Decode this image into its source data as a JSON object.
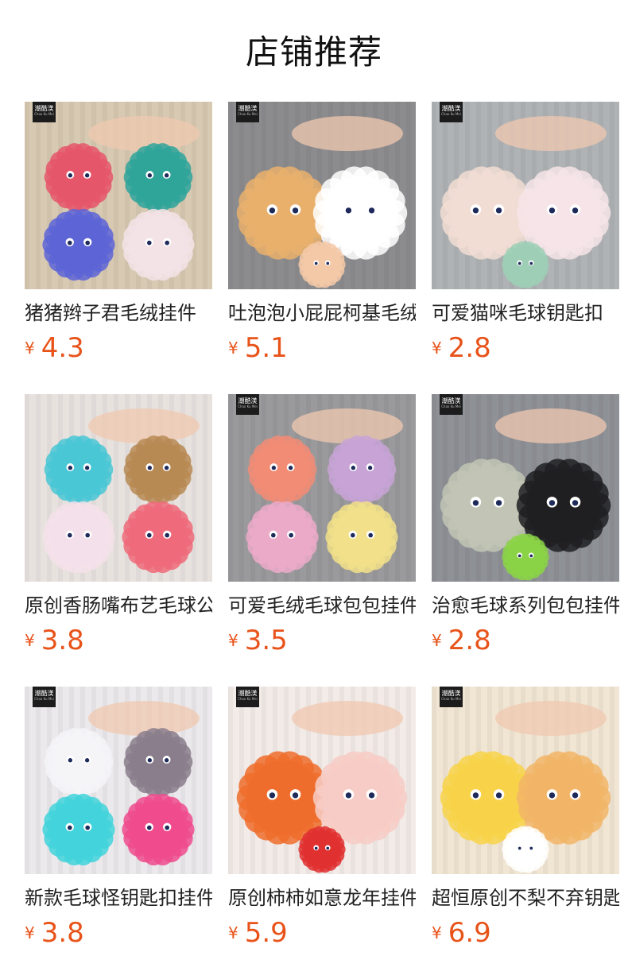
{
  "page": {
    "title": "店铺推荐"
  },
  "currency_symbol": "¥",
  "brand_badge": {
    "text": "潮酷渼",
    "sub": "Chao Ku Mei"
  },
  "products": [
    {
      "name": "猪猪辫子君毛绒挂件",
      "price": "4.3",
      "bg": "#d8c9b2",
      "colors": [
        "#e6566a",
        "#2fa59a",
        "#5d64d6",
        "#f3e3e6"
      ]
    },
    {
      "name": "吐泡泡小屁屁柯基毛绒挂件",
      "price": "5.1",
      "bg": "#8c8c8e",
      "colors": [
        "#e9b06c",
        "#ffffff",
        "#f4c9a8"
      ]
    },
    {
      "name": "可爱猫咪毛球钥匙扣",
      "price": "2.8",
      "bg": "#b0b3b5",
      "colors": [
        "#f1ddd4",
        "#f6e4e8",
        "#9ecfb6"
      ]
    },
    {
      "name": "原创香肠嘴布艺毛球公仔扣",
      "price": "3.8",
      "bg": "#e8e2df",
      "colors": [
        "#49c7d5",
        "#b78a53",
        "#f4e0ea",
        "#ef6a7a"
      ]
    },
    {
      "name": "可爱毛绒毛球包包挂件",
      "price": "3.5",
      "bg": "#9a9a9c",
      "colors": [
        "#f28c75",
        "#c7a3d6",
        "#ecaac9",
        "#f2e08a"
      ]
    },
    {
      "name": "治愈毛球系列包包挂件",
      "price": "2.8",
      "bg": "#8e9196",
      "colors": [
        "#c2c5b5",
        "#1f1f22",
        "#8bd346"
      ]
    },
    {
      "name": "新款毛球怪钥匙扣挂件",
      "price": "3.8",
      "bg": "#ece9ec",
      "colors": [
        "#f5f5f8",
        "#8a7e8c",
        "#42d3dc",
        "#ef4b8d"
      ]
    },
    {
      "name": "原创柿柿如意龙年挂件",
      "price": "5.9",
      "bg": "#f2ebe8",
      "colors": [
        "#ef6d2c",
        "#f7ccc6",
        "#e13030"
      ]
    },
    {
      "name": "超恒原创不梨不弃钥匙扣",
      "price": "6.9",
      "bg": "#f1e6d3",
      "colors": [
        "#f8d34a",
        "#f2b567",
        "#ffffff"
      ]
    }
  ]
}
